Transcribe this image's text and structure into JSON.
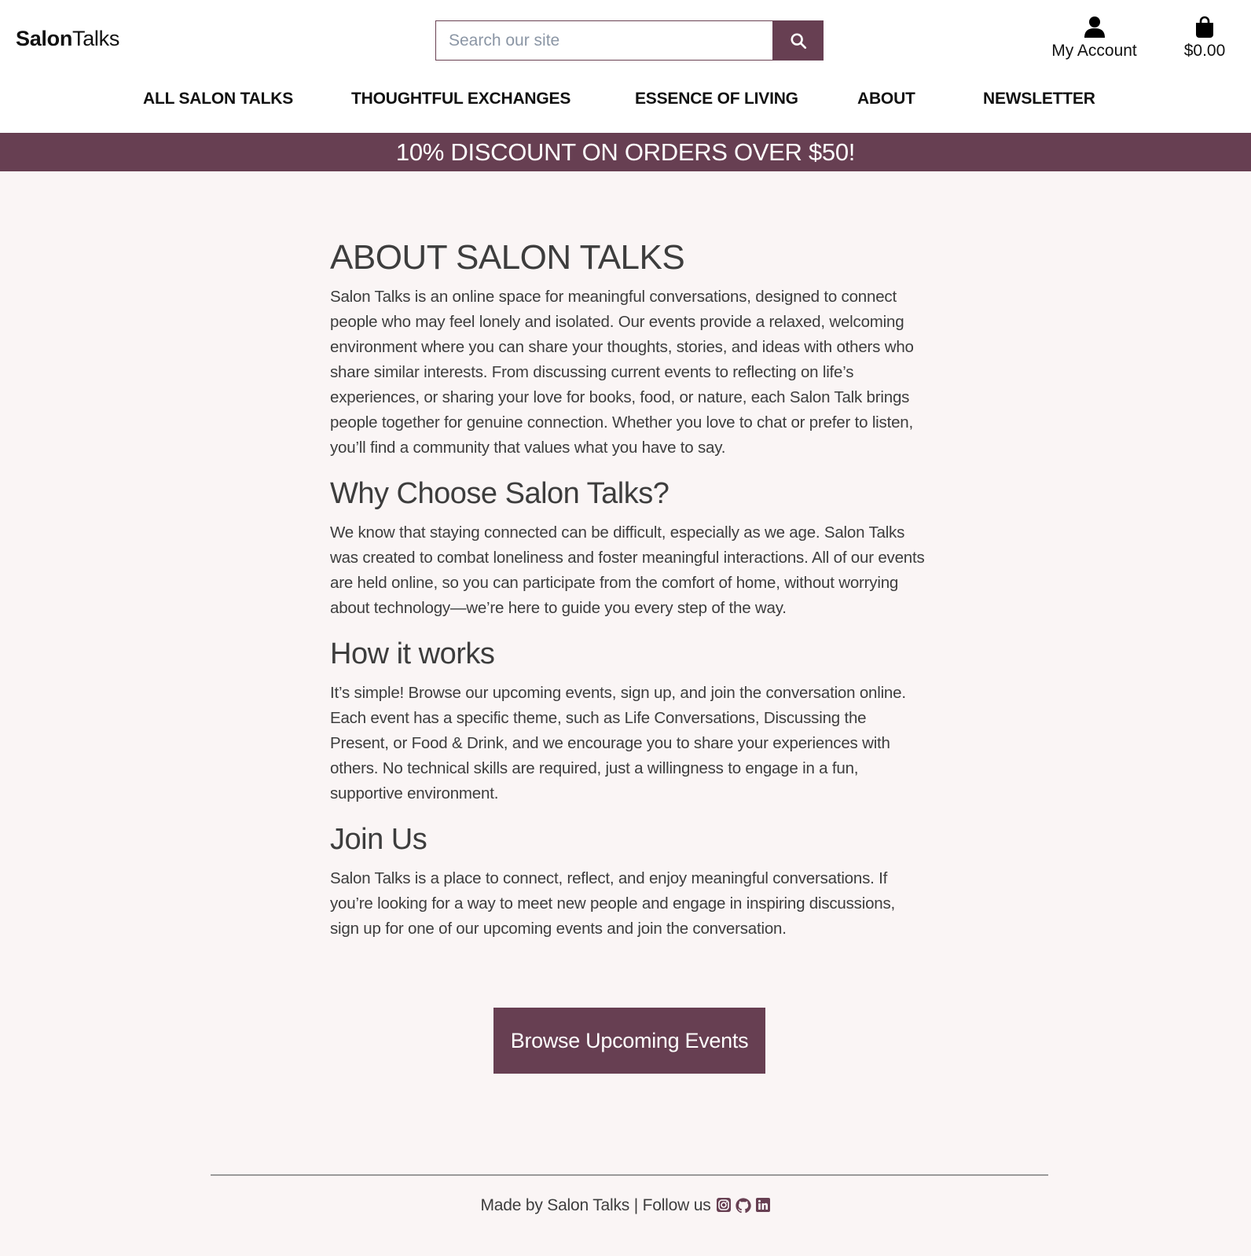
{
  "header": {
    "logo_bold": "Salon",
    "logo_regular": "Talks",
    "search_placeholder": "Search our site",
    "account_label": "My Account",
    "cart_total": "$0.00"
  },
  "nav": {
    "items": [
      {
        "label": "ALL SALON TALKS"
      },
      {
        "label": "THOUGHTFUL EXCHANGES"
      },
      {
        "label": "ESSENCE OF LIVING"
      },
      {
        "label": "ABOUT"
      },
      {
        "label": "NEWSLETTER"
      }
    ]
  },
  "banner": {
    "text": "10% DISCOUNT ON ORDERS OVER $50!"
  },
  "main": {
    "title": "ABOUT SALON TALKS",
    "intro": "Salon Talks is an online space for meaningful conversations, designed to connect people who may feel lonely and isolated. Our events provide a relaxed, welcoming environment where you can share your thoughts, stories, and ideas with others who share similar interests. From discussing current events to reflecting on life’s experiences, or sharing your love for books, food, or nature, each Salon Talk brings people together for genuine connection. Whether you love to chat or prefer to listen, you’ll find a community that values what you have to say.",
    "sections": [
      {
        "heading": "Why Choose Salon Talks?",
        "body": "We know that staying connected can be difficult, especially as we age. Salon Talks was created to combat loneliness and foster meaningful interactions. All of our events are held online, so you can participate from the comfort of home, without worrying about technology—we’re here to guide you every step of the way."
      },
      {
        "heading": "How it works",
        "body": "It’s simple! Browse our upcoming events, sign up, and join the conversation online. Each event has a specific theme, such as Life Conversations, Discussing the Present, or Food & Drink, and we encourage you to share your experiences with others. No technical skills are required, just a willingness to engage in a fun, supportive environment."
      },
      {
        "heading": "Join Us",
        "body": "Salon Talks is a place to connect, reflect, and enjoy meaningful conversations. If you’re looking for a way to meet new people and engage in inspiring discussions, sign up for one of our upcoming events and join the conversation."
      }
    ],
    "cta_label": "Browse Upcoming Events"
  },
  "footer": {
    "text": "Made by Salon Talks | Follow us",
    "icons": [
      "instagram-icon",
      "github-icon",
      "linkedin-icon"
    ]
  },
  "colors": {
    "brand": "#673f52",
    "page_background": "#faf5f5",
    "text": "#3d3d3d"
  }
}
